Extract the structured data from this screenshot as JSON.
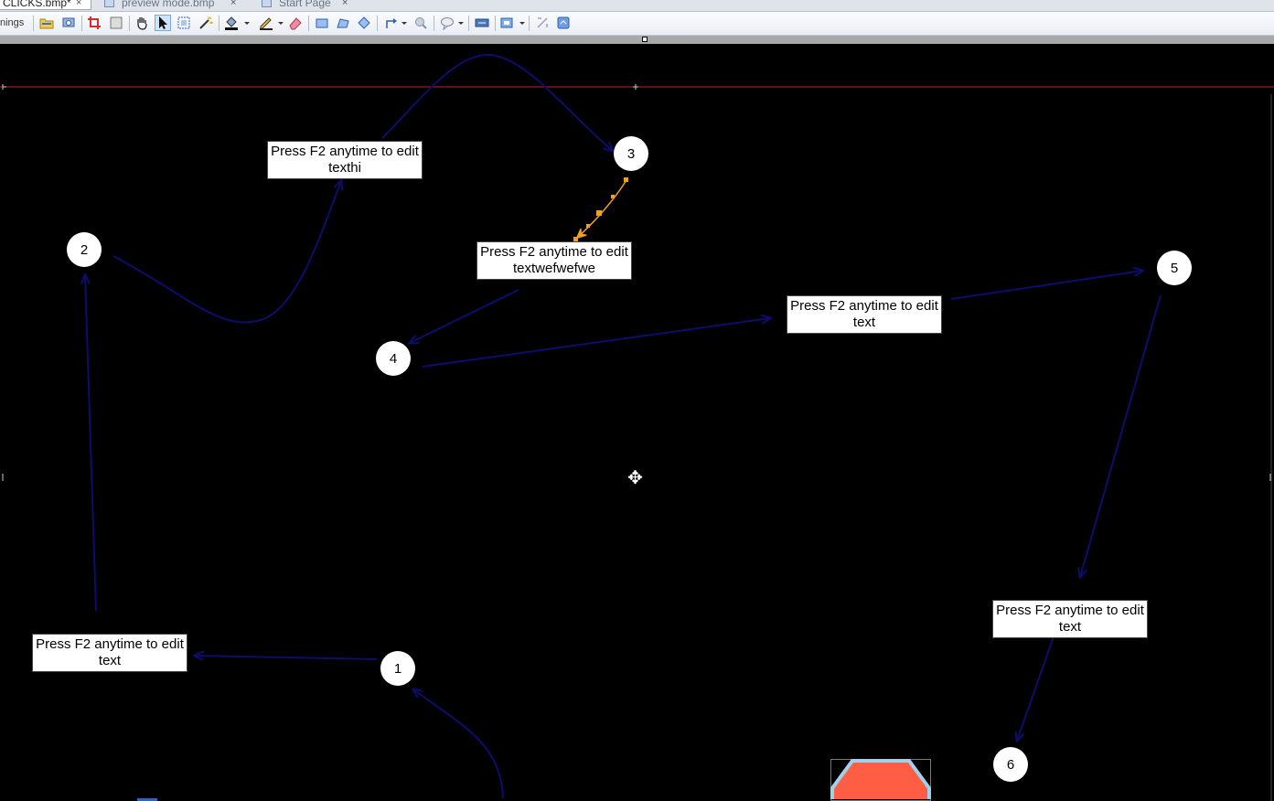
{
  "tabs": [
    {
      "label": "CLICKS.bmp*",
      "close": "×"
    },
    {
      "label": "preview mode.bmp",
      "close": "×"
    },
    {
      "label": "Start Page",
      "close": "×"
    }
  ],
  "toolbar": {
    "label": "nings",
    "tools": [
      "open-folder-icon",
      "capture-icon",
      "crop-icon",
      "resize-icon",
      "pan-hand-icon",
      "select-arrow-icon",
      "marquee-select-icon",
      "magic-wand-icon",
      "fill-icon",
      "pen-icon",
      "eraser-icon",
      "rectangle-icon",
      "polygon-icon",
      "ellipse-icon",
      "arrow-tool-icon",
      "magnifier-icon",
      "speech-bubble-icon",
      "text-box-icon",
      "step-number-icon",
      "stamp-icon",
      "border-effect-icon"
    ]
  },
  "callouts": [
    {
      "text": "Press F2 anytime to edit texthi"
    },
    {
      "text": "Press F2 anytime to edit textwefwefwe"
    },
    {
      "text": "Press F2 anytime to edit text"
    },
    {
      "text": "Press F2 anytime to edit text"
    },
    {
      "text": "Press F2 anytime to edit text"
    }
  ],
  "steps": [
    "1",
    "2",
    "3",
    "4",
    "5",
    "6"
  ],
  "colors": {
    "arrow": "#0d0d6e",
    "selected_arrow": "#f0a020",
    "guide_line": "#c0202a",
    "shape_fill": "#ff5e45",
    "shape_border": "#9fd2ea",
    "canvas": "#000000"
  }
}
